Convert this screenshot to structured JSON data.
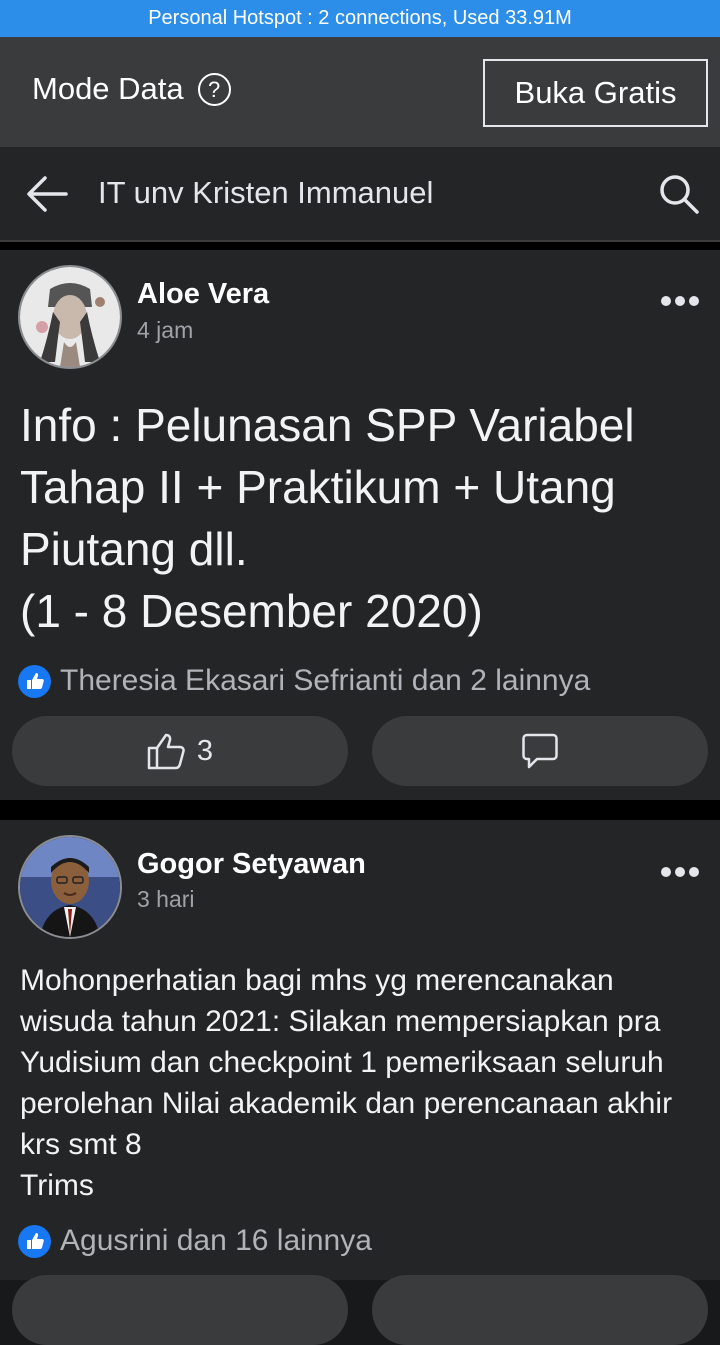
{
  "status_bar": {
    "text": "Personal Hotspot : 2 connections, Used 33.91M"
  },
  "mode_bar": {
    "title": "Mode Data",
    "help_icon": "?",
    "button_label": "Buka Gratis"
  },
  "search_bar": {
    "title": "IT unv Kristen Immanuel",
    "back_icon": "arrow-left-icon",
    "search_icon": "search-icon"
  },
  "posts": [
    {
      "author": "Aloe Vera",
      "time": "4 jam",
      "text": "Info : Pelunasan SPP Variabel Tahap II + Praktikum + Utang Piutang dll.\n(1 - 8 Desember 2020)",
      "reactions": "Theresia Ekasari Sefrianti dan 2 lainnya",
      "like_count": "3"
    },
    {
      "author": "Gogor Setyawan",
      "time": "3 hari",
      "text": "Mohonperhatian bagi mhs yg merencanakan wisuda tahun 2021: Silakan mempersiapkan pra Yudisium dan checkpoint 1 pemeriksaan seluruh perolehan Nilai akademik dan perencanaan akhir krs smt 8\nTrims",
      "reactions": "Agusrini dan 16 lainnya"
    }
  ],
  "colors": {
    "status_bar": "#2c8ee8",
    "like_blue": "#1877f2",
    "background": "#18191a",
    "card": "#242526"
  }
}
